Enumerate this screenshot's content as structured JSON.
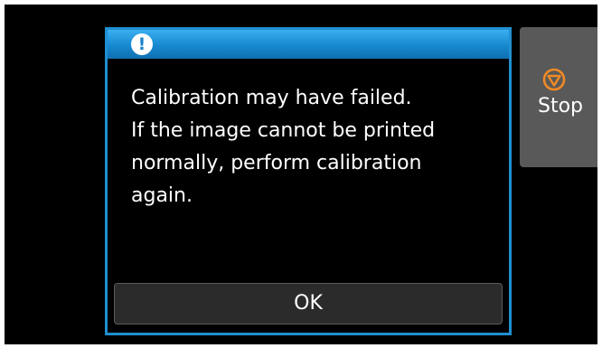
{
  "dialog": {
    "icon": "exclamation-icon",
    "message_lines": [
      "Calibration may have failed.",
      "If the image cannot be printed",
      "normally, perform calibration",
      "again."
    ],
    "ok_label": "OK"
  },
  "side_panel": {
    "stop_label": "Stop",
    "stop_icon": "stop-icon"
  },
  "colors": {
    "dialog_border": "#1f8fd0",
    "header": "#1789cf",
    "stop_icon": "#f08a24",
    "stop_button": "#595959"
  }
}
